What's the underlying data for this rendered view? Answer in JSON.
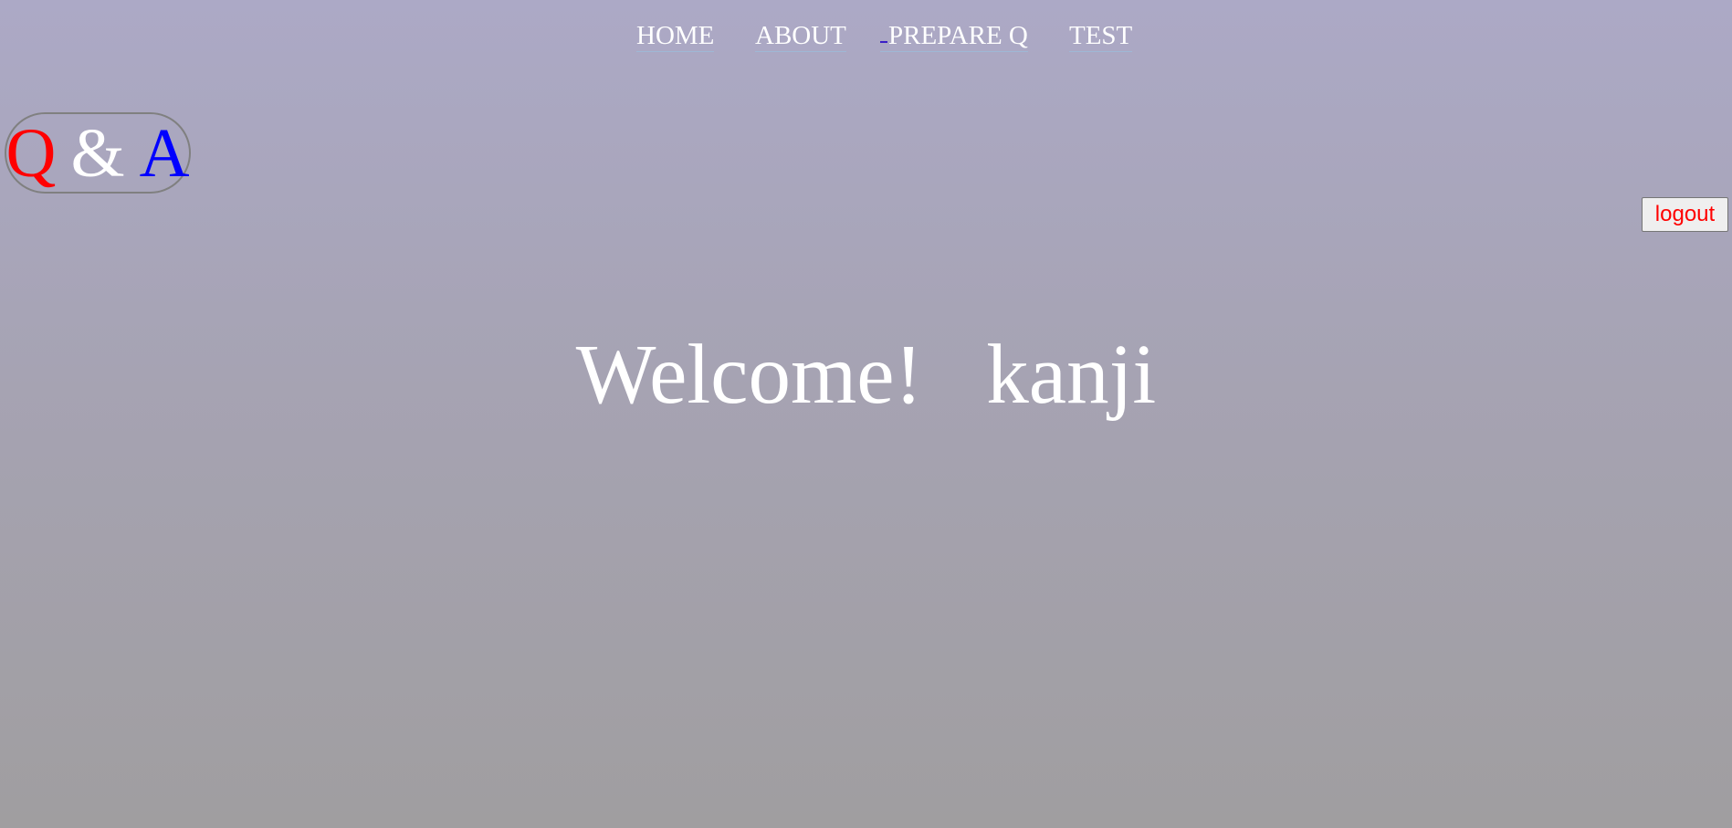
{
  "nav": {
    "items": [
      {
        "label": "HOME"
      },
      {
        "label": "ABOUT"
      },
      {
        "label": "PREPARE Q"
      },
      {
        "label": "TEST"
      }
    ]
  },
  "logo": {
    "q": "Q",
    "amp": "&",
    "a": "A"
  },
  "logout_label": "logout",
  "welcome": {
    "greeting": "Welcome!",
    "username": "kanji"
  },
  "colors": {
    "logo_q": "#ff0000",
    "logo_amp": "#ffffff",
    "logo_a": "#0000ff",
    "logout_text": "#ff0000",
    "background_top": "#aca9c6",
    "background_bottom": "#a09ea0"
  }
}
